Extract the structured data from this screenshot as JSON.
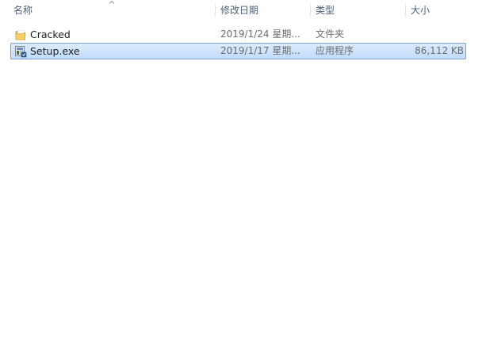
{
  "columns": {
    "name": "名称",
    "date": "修改日期",
    "type": "类型",
    "size": "大小"
  },
  "files": [
    {
      "name": "Cracked",
      "date": "2019/1/24 星期...",
      "type": "文件夹",
      "size": "",
      "icon": "folder-icon",
      "selected": false
    },
    {
      "name": "Setup.exe",
      "date": "2019/1/17 星期...",
      "type": "应用程序",
      "size": "86,112 KB",
      "icon": "installer-icon",
      "selected": true
    }
  ],
  "colors": {
    "header_text": "#4c607a",
    "selection_border": "#7da2ce",
    "selection_fill": "#c1dcfc",
    "secondary_text": "#6d6d6d"
  }
}
